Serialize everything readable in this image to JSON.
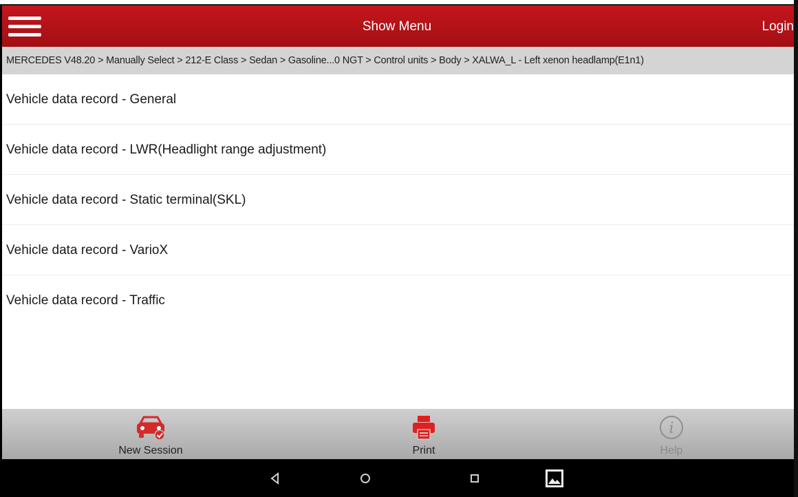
{
  "header": {
    "title": "Show Menu",
    "login_label": "Login",
    "accent_color": "#c4161c"
  },
  "breadcrumb": "MERCEDES V48.20 > Manually Select > 212-E Class > Sedan > Gasoline...0 NGT > Control units > Body > XALWA_L - Left xenon headlamp(E1n1)",
  "menu_items": [
    "Vehicle data record - General",
    "Vehicle data record - LWR(Headlight range adjustment)",
    "Vehicle data record - Static terminal(SKL)",
    "Vehicle data record - VarioX",
    "Vehicle data record - Traffic"
  ],
  "bottom_bar": {
    "new_session": {
      "label": "New Session",
      "icon": "car-icon"
    },
    "print": {
      "label": "Print",
      "icon": "printer-icon"
    },
    "help": {
      "label": "Help",
      "icon": "info-icon",
      "enabled": false
    }
  },
  "nav_bar": {
    "icons": [
      "back-icon",
      "home-icon",
      "recents-icon",
      "gallery-icon"
    ]
  }
}
